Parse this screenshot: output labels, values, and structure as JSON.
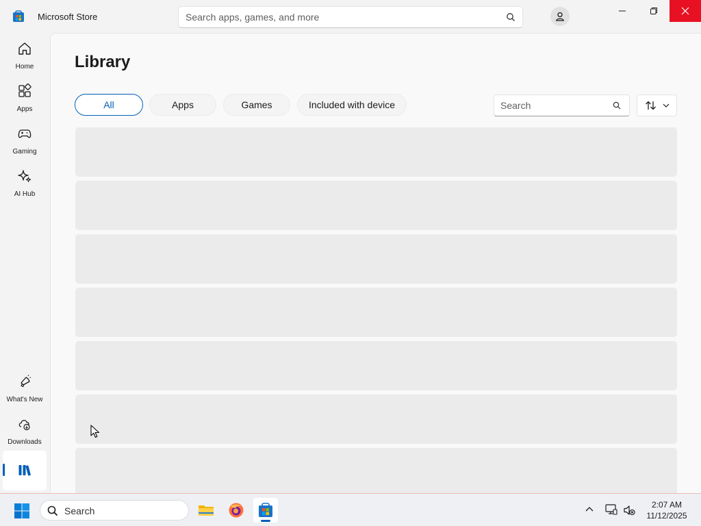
{
  "window": {
    "title": "Microsoft Store"
  },
  "header": {
    "search_placeholder": "Search apps, games, and more"
  },
  "nav": {
    "home": "Home",
    "apps": "Apps",
    "gaming": "Gaming",
    "ai_hub": "AI Hub",
    "whats_new": "What's New",
    "downloads": "Downloads"
  },
  "library": {
    "title": "Library",
    "filters": [
      "All",
      "Apps",
      "Games",
      "Included with device"
    ],
    "selected_filter": "All",
    "search_placeholder": "Search"
  },
  "taskbar": {
    "search_label": "Search",
    "time": "2:07 AM",
    "date": "11/12/2025"
  },
  "colors": {
    "accent": "#005fb8",
    "close_button": "#e81123"
  }
}
